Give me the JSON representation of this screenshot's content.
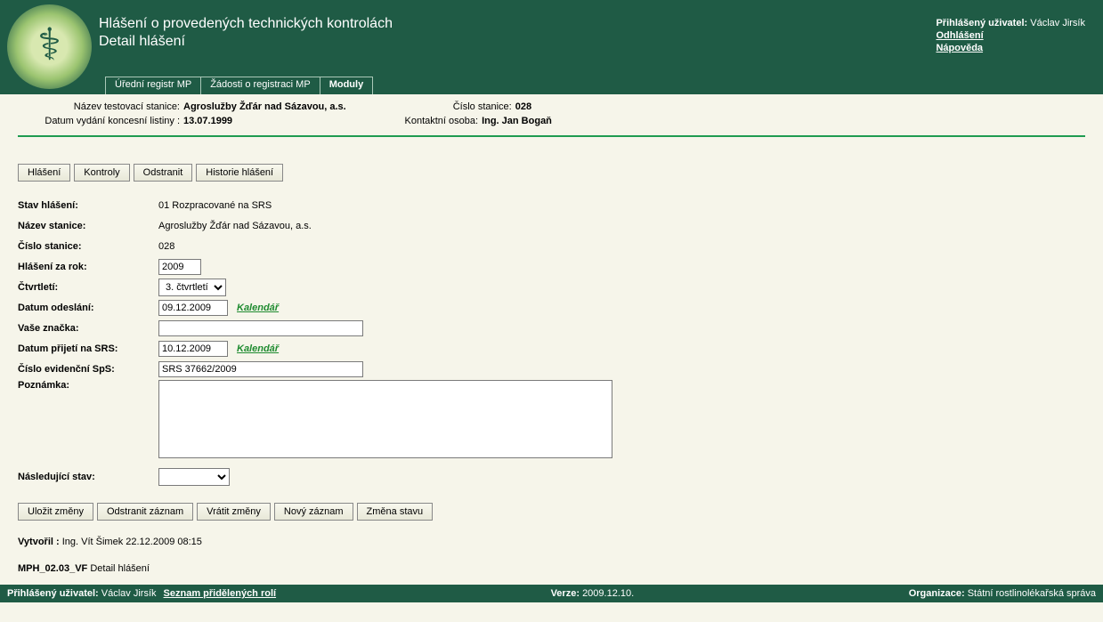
{
  "header": {
    "title1": "Hlášení o provedených technických kontrolách",
    "title2": "Detail hlášení",
    "user_label": "Přihlášený uživatel:",
    "user_name": "Václav Jirsík",
    "logout": "Odhlášení",
    "help": "Nápověda",
    "menu": [
      "Úřední registr MP",
      "Žádosti o registraci MP",
      "Moduly"
    ]
  },
  "info": {
    "station_name_label": "Název testovací stanice:",
    "station_name": "Agroslužby Žďár nad Sázavou, a.s.",
    "station_no_label": "Číslo stanice:",
    "station_no": "028",
    "license_date_label": "Datum vydání koncesní listiny :",
    "license_date": "13.07.1999",
    "contact_label": "Kontaktní osoba:",
    "contact": "Ing. Jan Bogaň"
  },
  "toolbar": [
    "Hlášení",
    "Kontroly",
    "Odstranit",
    "Historie hlášení"
  ],
  "form": {
    "stav_label": "Stav hlášení:",
    "stav_value": "01 Rozpracované na SRS",
    "nazev_label": "Název stanice:",
    "nazev_value": "Agroslužby Žďár nad Sázavou, a.s.",
    "cislo_label": "Číslo stanice:",
    "cislo_value": "028",
    "rok_label": "Hlášení za rok:",
    "rok_value": "2009",
    "ctvrt_label": "Čtvrtletí:",
    "ctvrt_value": "3. čtvrtletí",
    "odeslani_label": "Datum odeslání:",
    "odeslani_value": "09.12.2009",
    "kalendar": "Kalendář",
    "znacka_label": "Vaše značka:",
    "znacka_value": "",
    "prijeti_label": "Datum přijetí na SRS:",
    "prijeti_value": "10.12.2009",
    "evid_label": "Číslo evidenční SpS:",
    "evid_value": "SRS 37662/2009",
    "pozn_label": "Poznámka:",
    "pozn_value": "",
    "nasl_label": "Následující stav:",
    "nasl_value": ""
  },
  "actions": [
    "Uložit změny",
    "Odstranit záznam",
    "Vrátit změny",
    "Nový záznam",
    "Změna stavu"
  ],
  "meta": {
    "created_label": "Vytvořil :",
    "created_value": "Ing. Vít Šimek 22.12.2009 08:15",
    "page_code": "MPH_02.03_VF",
    "page_name": "Detail hlášení"
  },
  "footer": {
    "user_label": "Přihlášený uživatel:",
    "user_name": "Václav Jirsík",
    "roles_link": "Seznam přidělených rolí",
    "version_label": "Verze:",
    "version": "2009.12.10.",
    "org_label": "Organizace:",
    "org": "Státní rostlinolékařská správa"
  }
}
